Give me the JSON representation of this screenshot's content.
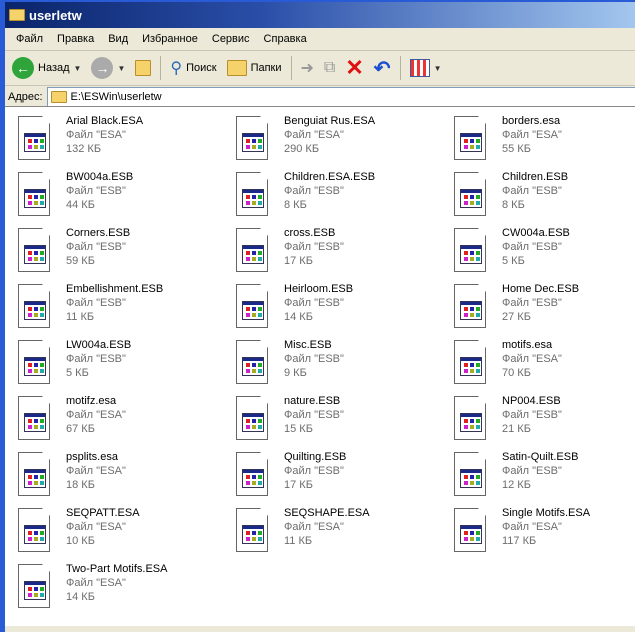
{
  "window": {
    "title": "userletw"
  },
  "menu": [
    "Файл",
    "Правка",
    "Вид",
    "Избранное",
    "Сервис",
    "Справка"
  ],
  "toolbar": {
    "back": "Назад",
    "search": "Поиск",
    "folders": "Папки"
  },
  "address": {
    "label": "Адрес:",
    "value": "E:\\ESWin\\userletw"
  },
  "files": [
    {
      "name": "Arial Black.ESA",
      "type": "Файл \"ESA\"",
      "size": "132 КБ"
    },
    {
      "name": "Benguiat Rus.ESA",
      "type": "Файл \"ESA\"",
      "size": "290 КБ"
    },
    {
      "name": "borders.esa",
      "type": "Файл \"ESA\"",
      "size": "55 КБ"
    },
    {
      "name": "BW004a.ESB",
      "type": "Файл \"ESB\"",
      "size": "44 КБ"
    },
    {
      "name": "Children.ESA.ESB",
      "type": "Файл \"ESB\"",
      "size": "8 КБ"
    },
    {
      "name": "Children.ESB",
      "type": "Файл \"ESB\"",
      "size": "8 КБ"
    },
    {
      "name": "Corners.ESB",
      "type": "Файл \"ESB\"",
      "size": "59 КБ"
    },
    {
      "name": "cross.ESB",
      "type": "Файл \"ESB\"",
      "size": "17 КБ"
    },
    {
      "name": "CW004a.ESB",
      "type": "Файл \"ESB\"",
      "size": "5 КБ"
    },
    {
      "name": "Embellishment.ESB",
      "type": "Файл \"ESB\"",
      "size": "11 КБ"
    },
    {
      "name": "Heirloom.ESB",
      "type": "Файл \"ESB\"",
      "size": "14 КБ"
    },
    {
      "name": "Home Dec.ESB",
      "type": "Файл \"ESB\"",
      "size": "27 КБ"
    },
    {
      "name": "LW004a.ESB",
      "type": "Файл \"ESB\"",
      "size": "5 КБ"
    },
    {
      "name": "Misc.ESB",
      "type": "Файл \"ESB\"",
      "size": "9 КБ"
    },
    {
      "name": "motifs.esa",
      "type": "Файл \"ESA\"",
      "size": "70 КБ"
    },
    {
      "name": "motifz.esa",
      "type": "Файл \"ESA\"",
      "size": "67 КБ"
    },
    {
      "name": "nature.ESB",
      "type": "Файл \"ESB\"",
      "size": "15 КБ"
    },
    {
      "name": "NP004.ESB",
      "type": "Файл \"ESB\"",
      "size": "21 КБ"
    },
    {
      "name": "psplits.esa",
      "type": "Файл \"ESA\"",
      "size": "18 КБ"
    },
    {
      "name": "Quilting.ESB",
      "type": "Файл \"ESB\"",
      "size": "17 КБ"
    },
    {
      "name": "Satin-Quilt.ESB",
      "type": "Файл \"ESB\"",
      "size": "12 КБ"
    },
    {
      "name": "SEQPATT.ESA",
      "type": "Файл \"ESA\"",
      "size": "10 КБ"
    },
    {
      "name": "SEQSHAPE.ESA",
      "type": "Файл \"ESA\"",
      "size": "11 КБ"
    },
    {
      "name": "Single Motifs.ESA",
      "type": "Файл \"ESA\"",
      "size": "117 КБ"
    },
    {
      "name": "Two-Part Motifs.ESA",
      "type": "Файл \"ESA\"",
      "size": "14 КБ"
    }
  ]
}
